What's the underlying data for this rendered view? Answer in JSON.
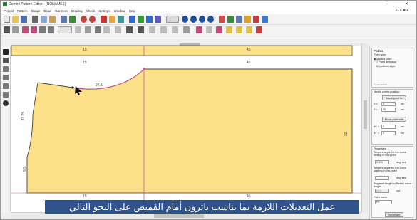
{
  "window": {
    "title": "Gemini Pattern Editor - [NONAME1]",
    "minimize": "–",
    "close": "✕"
  },
  "menu": [
    "Project",
    "Pattern",
    "Shape",
    "Draw",
    "Garment",
    "Grading",
    "Check",
    "Settings",
    "Window",
    "Help"
  ],
  "menu_right": "G ▾ ✱ ▾",
  "canvas": {
    "top_label_left": "15",
    "top_label_right": "45",
    "piece_label_left": "15",
    "piece_label_right": "45",
    "curve_label": "24.5",
    "side_label_upper": "11.75",
    "side_label_lower": "9.5",
    "right_label": "32",
    "bottom_label_left": "15",
    "bottom_label_right": "45",
    "piece_fill": "#fce08a",
    "outline_color": "#c95a8a"
  },
  "panel": {
    "points_title": "Points",
    "point_type_label": "Point type:",
    "graded_point": "graded point",
    "point_definition": "Point definition",
    "pattern_origin": "pattern origin",
    "on_curve": "on curve",
    "modify_label": "Modify points position",
    "move_point_to": "Move point to",
    "x_label": "X =",
    "x_value": "0",
    "y_label": "Y =",
    "y_value": "25",
    "x_unit": "cm",
    "y_unit": "cm",
    "move_point_with": "Move point with",
    "dx_label": "dX =",
    "dx_value": "0",
    "dy_label": "dY =",
    "dy_value": "0",
    "dx_unit": "cm",
    "dy_unit": "cm",
    "properties_title": "Properties",
    "tangent_ending_label": "Tangent angle for the curve ending in this point",
    "tangent_ending_value": "270.0",
    "degrees_1": "degrees",
    "tangent_starting_label": "Tangent angle for the curve starting in this point",
    "tangent_starting_value": "",
    "degrees_2": "degrees",
    "segment_label": "Segment length or Bezier curve length",
    "segment_value": "24.5",
    "segment_unit": "cm",
    "point_name_label": "Point name",
    "point_name_value": "P9",
    "set_origin": "Set origin"
  },
  "caption": "عمل التعديلات اللازمة بما يناسب باترون أمام القميص على النحو التالي"
}
